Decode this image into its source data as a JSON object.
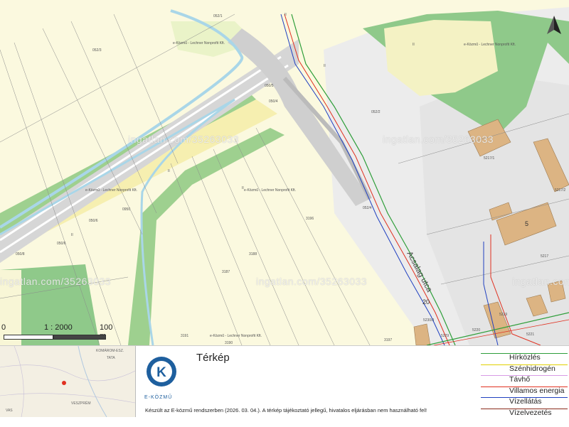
{
  "watermark": "ingatlan.com/35263033",
  "surveyor_credit": "e-Közmű - Lechner Nonprofit Kft.",
  "street_name": "Acsalag utca",
  "parcel_numbers": [
    "052/3",
    "050/4",
    "050/5",
    "052/2",
    "052/4",
    "0950",
    "050/6",
    "050/6",
    "050/8",
    "3187",
    "3188",
    "3190",
    "3191",
    "3196",
    "3197",
    "052/1",
    "5217/1",
    "5217/2",
    "5217",
    "5219",
    "5220",
    "5221",
    "5229",
    "5230/3"
  ],
  "house_numbers": [
    "5",
    "20"
  ],
  "land_marks": [
    "II",
    "II",
    "II",
    "II",
    "II",
    "II"
  ],
  "scale": {
    "start": "0",
    "ratio": "1 : 2000",
    "distance": "100 m"
  },
  "north_icon": "north-arrow-icon",
  "inset_places": [
    "KOMÁROM-ESZ.",
    "TATA",
    "VESZPRÉM",
    "VAS"
  ],
  "logo": {
    "letter": "K",
    "caption": "E-KÖZMŰ"
  },
  "title": "Térkép",
  "note": "Készült az E-közmű rendszerben (2026. 03. 04.). A térkép tájékoztató jellegű, hivatalos eljárásban nem használható fel!",
  "legend": [
    {
      "label": "Hírközlés",
      "color": "#2e9e3a"
    },
    {
      "label": "Szénhidrogén",
      "color": "#e0d000"
    },
    {
      "label": "Távhő",
      "color": "#d79be6"
    },
    {
      "label": "Villamos energia",
      "color": "#e03020"
    },
    {
      "label": "Vízellátás",
      "color": "#2040c0"
    },
    {
      "label": "Vízelvezetés",
      "color": "#8a2a1a"
    }
  ]
}
